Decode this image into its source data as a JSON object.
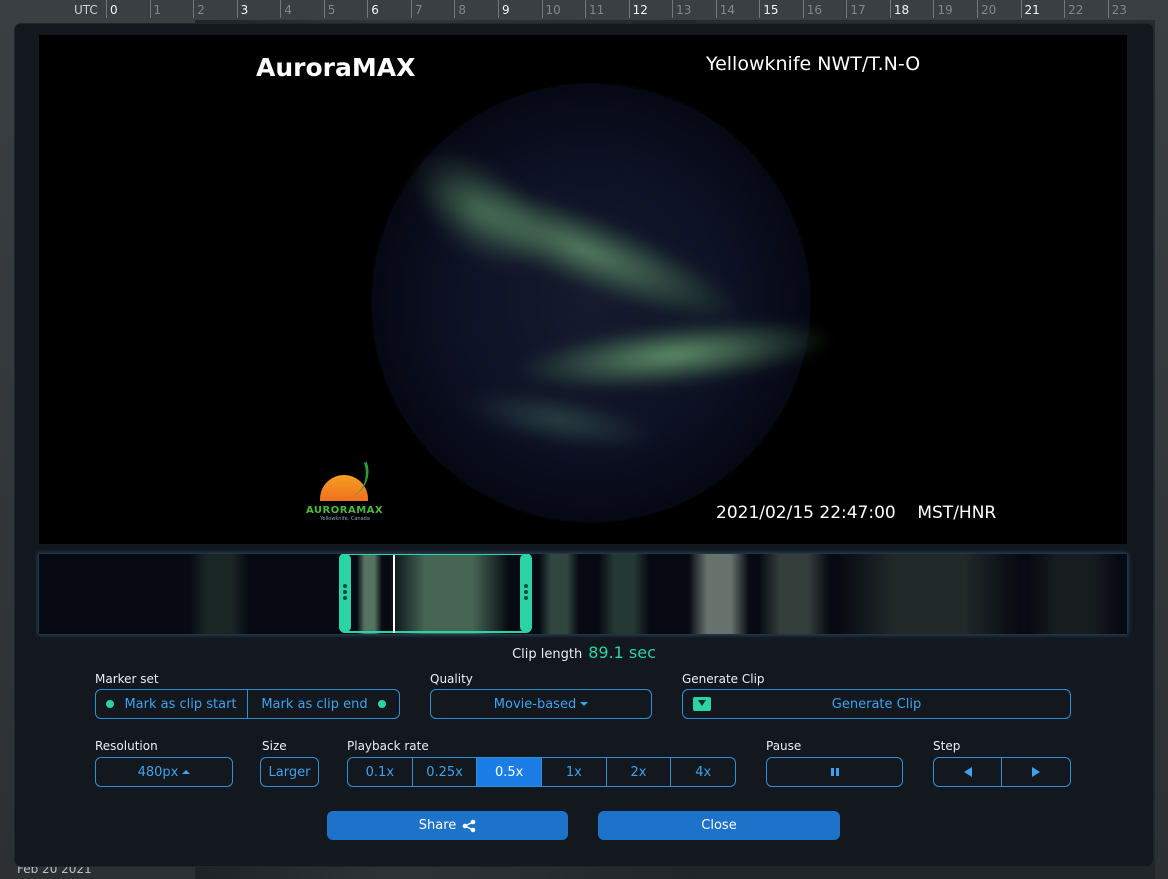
{
  "ruler": {
    "label": "UTC",
    "hours": [
      "0",
      "1",
      "2",
      "3",
      "4",
      "5",
      "6",
      "7",
      "8",
      "9",
      "10",
      "11",
      "12",
      "13",
      "14",
      "15",
      "16",
      "17",
      "18",
      "19",
      "20",
      "21",
      "22",
      "23"
    ],
    "major_hours": [
      "0",
      "3",
      "6",
      "9",
      "12",
      "15",
      "18",
      "21"
    ]
  },
  "background": {
    "date_label": "Feb 20 2021"
  },
  "viewer": {
    "title": "AuroraMAX",
    "location": "Yellowknife NWT/T.N-O",
    "timestamp": "2021/02/15 22:47:00    MST/HNR",
    "logo_text": "AURORAMAX",
    "logo_sub": "Yellowknife, Canada"
  },
  "clip": {
    "label": "Clip length",
    "value": "89.1 sec"
  },
  "marker_set": {
    "label": "Marker set",
    "start_label": "Mark as clip start",
    "end_label": "Mark as clip end"
  },
  "quality": {
    "label": "Quality",
    "value": "Movie-based"
  },
  "generate": {
    "label": "Generate Clip",
    "button_label": "Generate Clip",
    "icon": "download-icon"
  },
  "resolution": {
    "label": "Resolution",
    "value": "480px"
  },
  "size": {
    "label": "Size",
    "button_label": "Larger"
  },
  "playback": {
    "label": "Playback rate",
    "rates": [
      "0.1x",
      "0.25x",
      "0.5x",
      "1x",
      "2x",
      "4x"
    ],
    "active": "0.5x"
  },
  "pause": {
    "label": "Pause",
    "icon": "pause-icon"
  },
  "step": {
    "label": "Step",
    "icons": [
      "step-back-icon",
      "step-forward-icon"
    ]
  },
  "actions": {
    "share_label": "Share",
    "close_label": "Close"
  },
  "colors": {
    "accent": "#2ad4a5",
    "primary": "#1d73c9",
    "border": "#2f8fd6"
  }
}
